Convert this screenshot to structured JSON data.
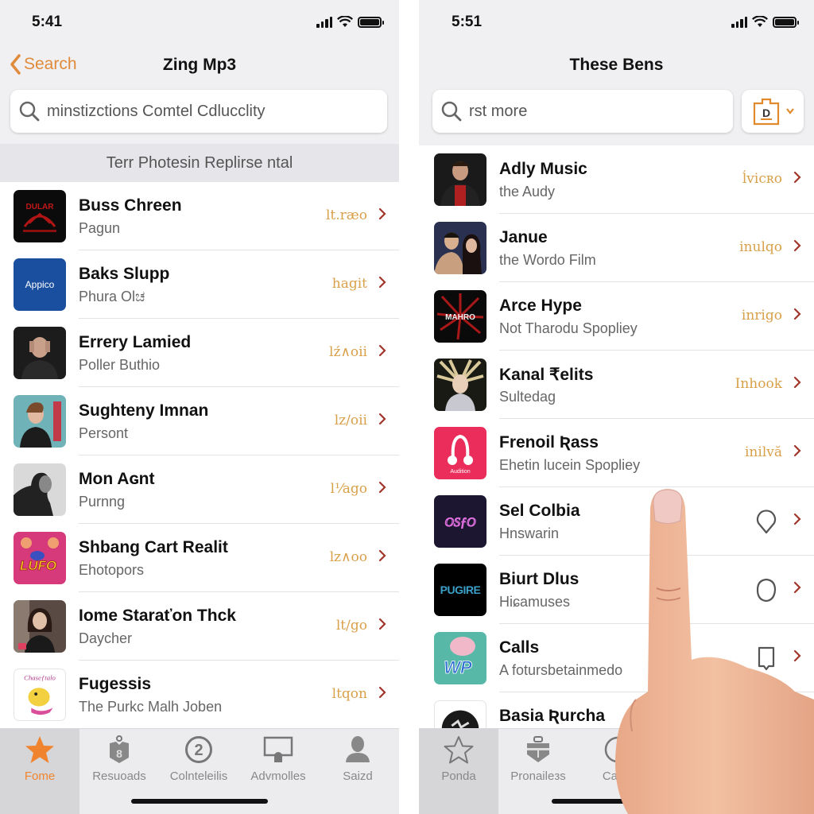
{
  "left": {
    "status": {
      "time": "5:41"
    },
    "nav": {
      "back_label": "Search",
      "title": "Zing Mp3"
    },
    "search": {
      "value": "minstizctions Comtel Cdlucclity",
      "placeholder": ""
    },
    "section_header": "Terr Photesin Replirse ntal",
    "items": [
      {
        "title": "Buss Chreen",
        "subtitle": "Pagun",
        "meta": "lt.ræo",
        "thumb_label": "DULAR"
      },
      {
        "title": "Baks Slupp",
        "subtitle": "Phura Olಚ",
        "meta": "hagit",
        "thumb_label": "Appico"
      },
      {
        "title": "Errery Lamied",
        "subtitle": "Poller Buthio",
        "meta": "lź∧oii",
        "thumb_label": ""
      },
      {
        "title": "Sughteny Imnan",
        "subtitle": "Persont",
        "meta": "lz∕oii",
        "thumb_label": ""
      },
      {
        "title": "Mon Aɢnt",
        "subtitle": "Purnng",
        "meta": "l⅟ago",
        "thumb_label": ""
      },
      {
        "title": "Shbang Cart Realit",
        "subtitle": "Ehotopors",
        "meta": "lz∧oo",
        "thumb_label": "LUFO"
      },
      {
        "title": "Iome Staraťon Thck",
        "subtitle": "Daycher",
        "meta": "lt∕go",
        "thumb_label": ""
      },
      {
        "title": "Fugessis",
        "subtitle": "The Purkc Malh Joben",
        "meta": "ltqon",
        "thumb_label": ""
      }
    ],
    "tabs": [
      {
        "label": "Fome",
        "icon": "star-filled-icon",
        "active": true
      },
      {
        "label": "Resuoads",
        "icon": "tag-icon",
        "active": false
      },
      {
        "label": "Colnteleilis",
        "icon": "number-circle-icon",
        "active": false
      },
      {
        "label": "Advmolles",
        "icon": "screen-share-icon",
        "active": false
      },
      {
        "label": "Saizd",
        "icon": "person-icon",
        "active": false
      }
    ]
  },
  "right": {
    "status": {
      "time": "5:51"
    },
    "nav": {
      "title": "These Bens"
    },
    "search": {
      "value": "rst more",
      "placeholder": ""
    },
    "filter_button": {
      "letter": "D",
      "icon": "calendar-dropdown-icon"
    },
    "items": [
      {
        "title": "Adly Music",
        "subtitle": "the Audy",
        "meta": "ĺvicʀo",
        "trailing": "text"
      },
      {
        "title": "Janue",
        "subtitle": "the Wordo Film",
        "meta": "inulqo",
        "trailing": "text"
      },
      {
        "title": "Arce Hype",
        "subtitle": "Not Tharodu Spopliey",
        "meta": "inrigo",
        "trailing": "text",
        "thumb_label": "MAHRO"
      },
      {
        "title": "Kanal ₹elits",
        "subtitle": "Sultedag",
        "meta": "Inhook",
        "trailing": "text"
      },
      {
        "title": "Frenoil Ʀass",
        "subtitle": "Ehetin lucein Spopliey",
        "meta": "inilvă",
        "trailing": "text",
        "thumb_label": "Audition"
      },
      {
        "title": "Sel Colbia",
        "subtitle": "Hnswarin",
        "trailing": "pin-icon",
        "thumb_label": "OSƒO"
      },
      {
        "title": "Biurt Dlus",
        "subtitle": "Hiɕamuses",
        "trailing": "circle-icon",
        "thumb_label": "PUGIRE"
      },
      {
        "title": "Calls",
        "subtitle": "A fotursbetainmedo",
        "trailing": "bookmark-icon",
        "thumb_label": "WP"
      },
      {
        "title": "Basia Ʀurcha",
        "subtitle": "",
        "trailing": "none"
      }
    ],
    "tabs": [
      {
        "label": "Ponda",
        "icon": "star-outline-icon",
        "active": true
      },
      {
        "label": "Pronaileзs",
        "icon": "briefcase-icon",
        "active": false
      },
      {
        "label": "Caldv",
        "icon": "circle-icon",
        "active": false
      }
    ]
  },
  "colors": {
    "accent_orange": "#f0842e",
    "meta_gold": "#d9a04a",
    "chevron_red": "#a0362c",
    "background_gray": "#f0f0f2"
  }
}
